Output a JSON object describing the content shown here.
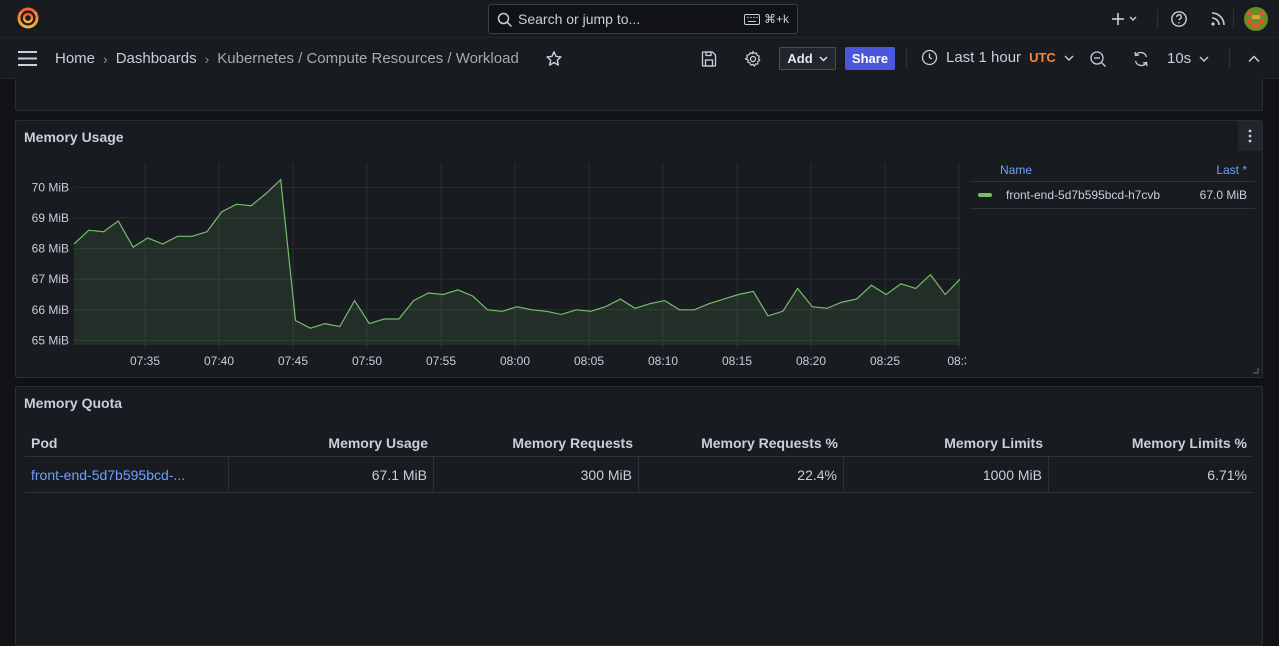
{
  "topbar": {
    "search_placeholder": "Search or jump to...",
    "search_shortcut": "⌘+k"
  },
  "navbar": {
    "breadcrumbs": [
      "Home",
      "Dashboards",
      "Kubernetes / Compute Resources / Workload"
    ],
    "add_label": "Add",
    "share_label": "Share",
    "time_range": "Last 1 hour",
    "timezone": "UTC",
    "refresh_interval": "10s"
  },
  "panels": {
    "memory_usage": {
      "title": "Memory Usage",
      "legend": {
        "name_header": "Name",
        "last_header": "Last *",
        "series_name": "front-end-5d7b595bcd-h7cvb",
        "series_last": "67.0 MiB",
        "series_color": "#73bf69"
      }
    },
    "memory_quota": {
      "title": "Memory Quota",
      "columns": [
        "Pod",
        "Memory Usage",
        "Memory Requests",
        "Memory Requests %",
        "Memory Limits",
        "Memory Limits %"
      ],
      "rows": [
        [
          "front-end-5d7b595bcd-...",
          "67.1 MiB",
          "300 MiB",
          "22.4%",
          "1000 MiB",
          "6.71%"
        ]
      ]
    }
  },
  "chart_data": {
    "type": "area",
    "yticks": [
      "65 MiB",
      "66 MiB",
      "67 MiB",
      "68 MiB",
      "69 MiB",
      "70 MiB"
    ],
    "ylim": [
      64.85,
      70.6
    ],
    "xticks": [
      "07:35",
      "07:40",
      "07:45",
      "07:50",
      "07:55",
      "08:00",
      "08:05",
      "08:10",
      "08:15",
      "08:20",
      "08:25",
      "08:3"
    ],
    "series": [
      {
        "name": "front-end-5d7b595bcd-h7cvb",
        "color": "#73bf69",
        "values": [
          68.15,
          68.6,
          68.55,
          68.9,
          68.05,
          68.35,
          68.15,
          68.4,
          68.4,
          68.55,
          69.2,
          69.45,
          69.4,
          69.8,
          70.25,
          65.65,
          65.4,
          65.55,
          65.45,
          66.3,
          65.55,
          65.7,
          65.7,
          66.3,
          66.55,
          66.5,
          66.65,
          66.45,
          66.0,
          65.95,
          66.1,
          66.0,
          65.95,
          65.85,
          66.0,
          65.95,
          66.1,
          66.35,
          66.05,
          66.2,
          66.3,
          66.0,
          66.0,
          66.2,
          66.35,
          66.5,
          66.6,
          65.8,
          65.95,
          66.7,
          66.1,
          66.05,
          66.25,
          66.35,
          66.8,
          66.5,
          66.85,
          66.7,
          67.15,
          66.5,
          67.0
        ]
      }
    ]
  }
}
